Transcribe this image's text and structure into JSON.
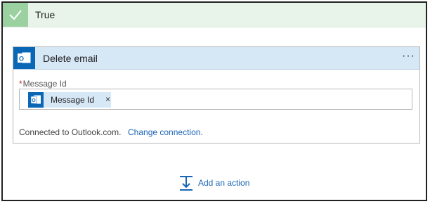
{
  "condition": {
    "label": "True",
    "accent_color": "#9bd1a1"
  },
  "action_card": {
    "title": "Delete email",
    "more_label": "···",
    "icon": "outlook-icon",
    "field": {
      "required_mark": "*",
      "label": "Message Id",
      "token": {
        "label": "Message Id",
        "remove_label": "×",
        "icon": "outlook-icon"
      }
    },
    "connection_text": "Connected to Outlook.com.",
    "change_connection_label": "Change connection."
  },
  "add_action": {
    "label": "Add an action",
    "icon": "insert-step-icon"
  },
  "colors": {
    "brand_blue": "#0a67b6",
    "link_blue": "#1b65b5",
    "header_bg": "#d6e7f6"
  }
}
